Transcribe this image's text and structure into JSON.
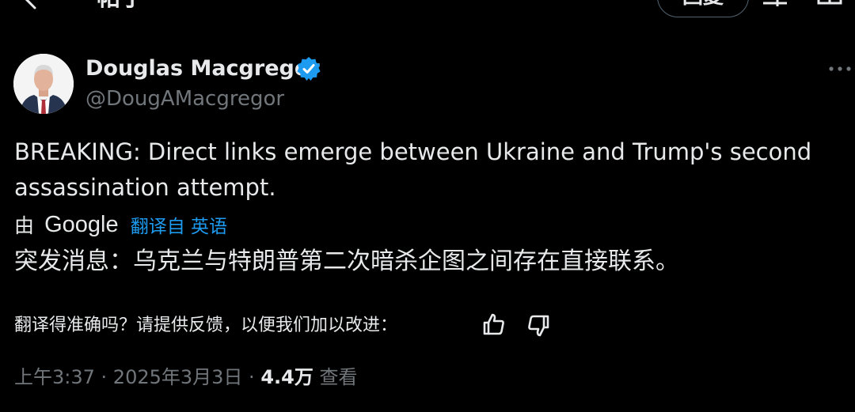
{
  "header": {
    "title": "帖子",
    "reply_label": "回复"
  },
  "author": {
    "name": "Douglas Macgregor",
    "handle": "@DougAMacgregor"
  },
  "tweet": {
    "text": "BREAKING: Direct links emerge between Ukraine and Trump's second assassination attempt.",
    "translated_by_prefix": "由",
    "translator": "Google",
    "translate_link": "翻译自 英语",
    "translated_text": "突发消息：乌克兰与特朗普第二次暗杀企图之间存在直接联系。",
    "feedback_question": "翻译得准确吗？请提供反馈，以便我们加以改进："
  },
  "meta": {
    "time": "上午3:37",
    "separator_1": " · ",
    "date": "2025年3月3日",
    "separator_2": " · ",
    "views_count": "4.4万",
    "views_label": " 查看"
  },
  "icons": {
    "back": "back-arrow-icon",
    "verified": "verified-badge-icon",
    "more": "more-icon",
    "thumbs_up": "thumbs-up-icon",
    "thumbs_down": "thumbs-down-icon"
  },
  "colors": {
    "background": "#000000",
    "text": "#e7e9ea",
    "secondary_text": "#71767b",
    "link": "#1d9bf0",
    "verified": "#1d9bf0"
  }
}
